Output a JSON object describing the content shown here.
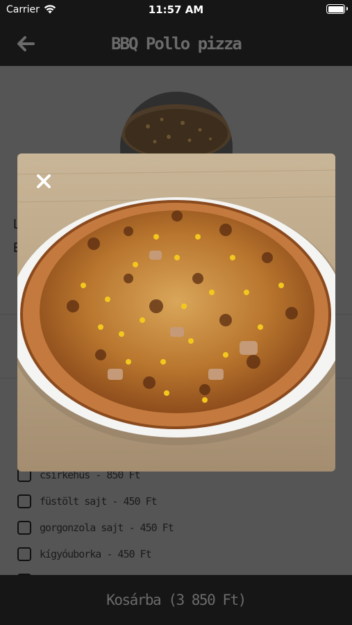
{
  "status_bar": {
    "carrier": "Carrier",
    "time": "11:57 AM"
  },
  "nav": {
    "title": "BBQ Pollo pizza",
    "back_icon": "arrow-left-icon"
  },
  "product": {
    "description_line_1": "L",
    "description_line_2": "E"
  },
  "extras": [
    {
      "label": "csirkehús - 850 Ft",
      "checked": false
    },
    {
      "label": "füstölt sajt - 450 Ft",
      "checked": false
    },
    {
      "label": "gorgonzola sajt - 450 Ft",
      "checked": false
    },
    {
      "label": "kígyóuborka - 450 Ft",
      "checked": false
    }
  ],
  "cart": {
    "button_label": "Kosárba (3 850 Ft)"
  },
  "popup": {
    "close_icon": "close-icon"
  },
  "colors": {
    "bar_background": "#161616",
    "screen_dim": "#555555",
    "muted_text": "#6b6b6b",
    "photo_wood": "#bfa78a",
    "plate": "#f4f4f2",
    "pizza_crust": "#c47a3e"
  }
}
